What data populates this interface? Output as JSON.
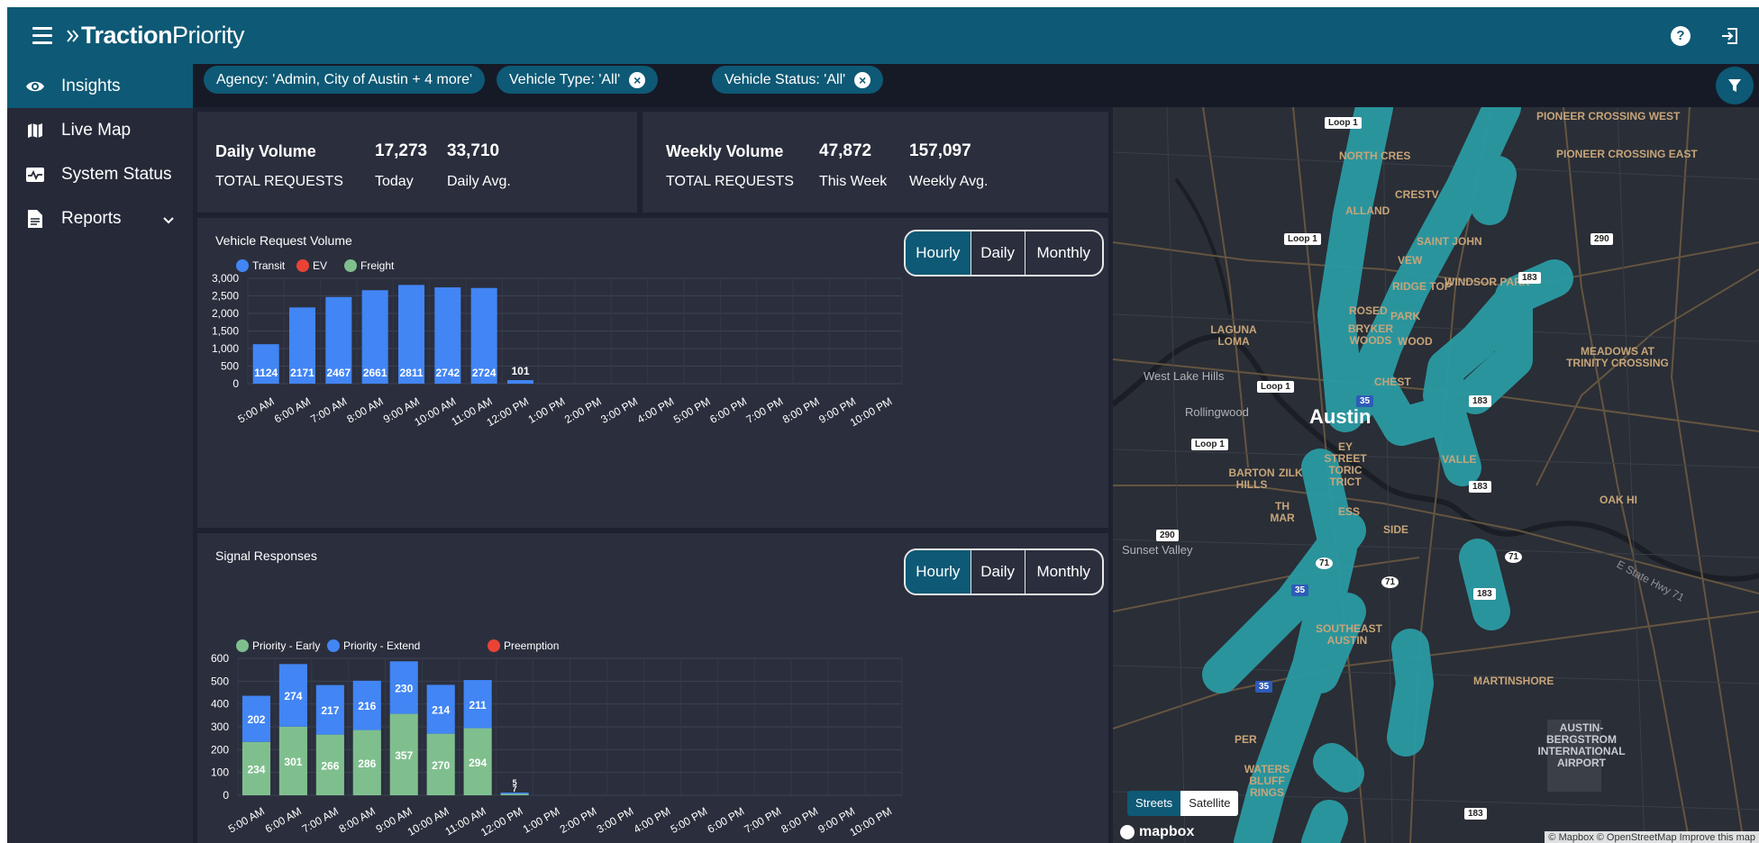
{
  "app": {
    "name_bold": "Traction",
    "name_light": "Priority"
  },
  "sidebar": {
    "items": [
      {
        "label": "Insights",
        "icon": "eye-icon"
      },
      {
        "label": "Live Map",
        "icon": "map-icon"
      },
      {
        "label": "System Status",
        "icon": "pulse-icon"
      },
      {
        "label": "Reports",
        "icon": "document-icon"
      }
    ]
  },
  "filters": {
    "chips": [
      {
        "label": "Agency: 'Admin, City of Austin + 4 more'"
      },
      {
        "label": "Vehicle Type: 'All'"
      },
      {
        "label": "Vehicle Status: 'All'"
      }
    ]
  },
  "daily": {
    "title": "Daily Volume",
    "subtitle": "TOTAL REQUESTS",
    "today_value": "17,273",
    "today_label": "Today",
    "avg_value": "33,710",
    "avg_label": "Daily Avg."
  },
  "weekly": {
    "title": "Weekly Volume",
    "subtitle": "TOTAL REQUESTS",
    "week_value": "47,872",
    "week_label": "This Week",
    "avg_value": "157,097",
    "avg_label": "Weekly Avg."
  },
  "toggle": {
    "hourly": "Hourly",
    "daily": "Daily",
    "monthly": "Monthly"
  },
  "colors": {
    "accent": "#0e5975",
    "transit": "#4285f4",
    "ev": "#ea4335",
    "freight": "#7fbf8e",
    "early": "#7fbf8e",
    "extend": "#4285f4",
    "preemption": "#ea4335"
  },
  "chart_data": [
    {
      "type": "bar",
      "title": "Vehicle Request Volume",
      "categories": [
        "5:00 AM",
        "6:00 AM",
        "7:00 AM",
        "8:00 AM",
        "9:00 AM",
        "10:00 AM",
        "11:00 AM",
        "12:00 PM",
        "1:00 PM",
        "2:00 PM",
        "3:00 PM",
        "4:00 PM",
        "5:00 PM",
        "6:00 PM",
        "7:00 PM",
        "8:00 PM",
        "9:00 PM",
        "10:00 PM"
      ],
      "series": [
        {
          "name": "Transit",
          "values": [
            1124,
            2171,
            2467,
            2661,
            2811,
            2742,
            2724,
            101,
            null,
            null,
            null,
            null,
            null,
            null,
            null,
            null,
            null,
            null
          ]
        },
        {
          "name": "EV",
          "values": []
        },
        {
          "name": "Freight",
          "values": []
        }
      ],
      "yticks": [
        "0",
        "500",
        "1,000",
        "1,500",
        "2,000",
        "2,500",
        "3,000"
      ],
      "ylim": [
        0,
        3000
      ]
    },
    {
      "type": "bar",
      "title": "Signal Responses",
      "stacked": true,
      "categories": [
        "5:00 AM",
        "6:00 AM",
        "7:00 AM",
        "8:00 AM",
        "9:00 AM",
        "10:00 AM",
        "11:00 AM",
        "12:00 PM",
        "1:00 PM",
        "2:00 PM",
        "3:00 PM",
        "4:00 PM",
        "5:00 PM",
        "6:00 PM",
        "7:00 PM",
        "8:00 PM",
        "9:00 PM",
        "10:00 PM"
      ],
      "series": [
        {
          "name": "Priority - Early",
          "values": [
            234,
            301,
            266,
            286,
            357,
            270,
            294,
            7,
            null,
            null,
            null,
            null,
            null,
            null,
            null,
            null,
            null,
            null
          ]
        },
        {
          "name": "Priority - Extend",
          "values": [
            202,
            274,
            217,
            216,
            230,
            214,
            211,
            5,
            null,
            null,
            null,
            null,
            null,
            null,
            null,
            null,
            null,
            null
          ]
        },
        {
          "name": "Preemption",
          "values": []
        }
      ],
      "yticks": [
        "0",
        "100",
        "200",
        "300",
        "400",
        "500",
        "600"
      ],
      "ylim": [
        0,
        600
      ]
    }
  ],
  "map": {
    "labels": {
      "pioneer_west": "PIONEER CROSSING WEST",
      "pioneer_east": "PIONEER CROSSING EAST",
      "north_cres": "NORTH CRES",
      "crestview": "CRESTV",
      "allandale": "ALLAND",
      "saint_john": "SAINT JOHN",
      "windsor_park": "WINDSOR PARK",
      "ridge_top": "RIDGE TOP",
      "rosedale": "ROSED",
      "bryker_woods": "BRYKER WOODS",
      "laguna_loma": "LAGUNA LOMA",
      "west_lake_hills": "West Lake Hills",
      "meadows": "MEADOWS AT TRINITY CROSSING",
      "rollingwood": "Rollingwood",
      "austin": "Austin",
      "barton_hills": "BARTON HILLS",
      "sunset_valley": "Sunset Valley",
      "southeast_austin": "SOUTHEAST AUSTIN",
      "martinshore": "MARTINSHORE",
      "airport": "Austin-Bergstrom International Airport",
      "oak_hill": "OAK HI",
      "east_hwy": "E State Hwy 71",
      "park": "PARK",
      "wood": "WOOD",
      "chest": "CHEST",
      "valle": "VALLE",
      "ey_street": "EY STREET TORIC TRICT",
      "zilk": "ZILK",
      "mar": "TH MAR",
      "ess": "ESS",
      "side": "SIDE",
      "vew": "VEW",
      "per": "PER",
      "waters": "WATERS BLUFF RINGS"
    },
    "shields": {
      "loop1": "Loop 1",
      "i35": "35",
      "us183": "183",
      "us290": "290",
      "sh71": "71"
    },
    "toggle_streets": "Streets",
    "toggle_satellite": "Satellite",
    "brand": "mapbox",
    "attribution": "© Mapbox © OpenStreetMap  Improve this map"
  }
}
